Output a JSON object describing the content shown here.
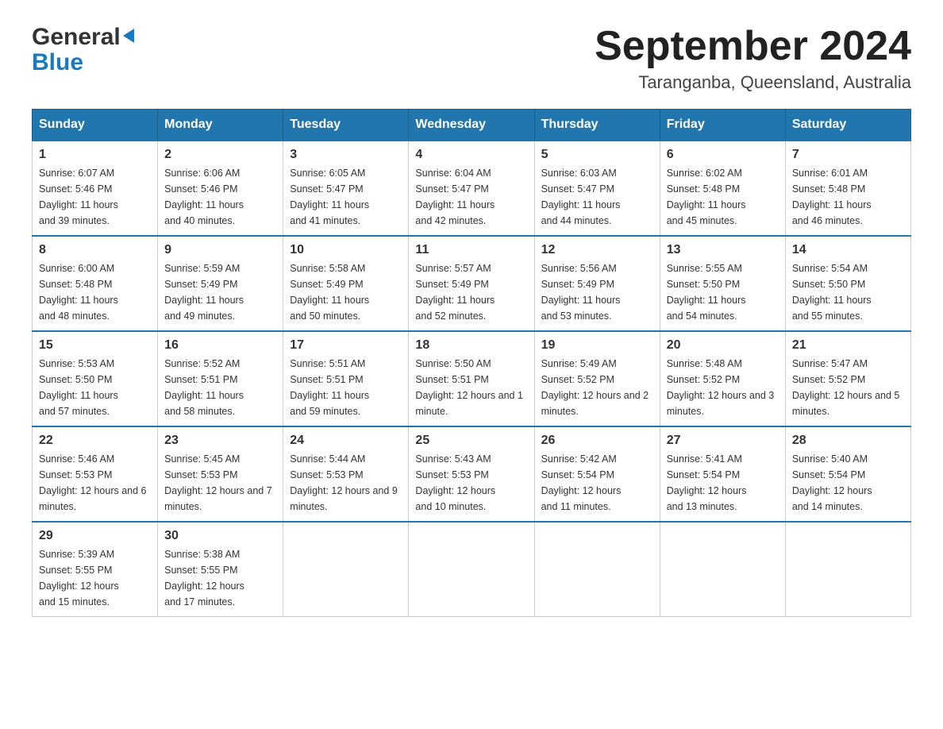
{
  "header": {
    "logo_general": "General",
    "logo_blue": "Blue",
    "month_title": "September 2024",
    "location": "Taranganba, Queensland, Australia"
  },
  "weekdays": [
    "Sunday",
    "Monday",
    "Tuesday",
    "Wednesday",
    "Thursday",
    "Friday",
    "Saturday"
  ],
  "weeks": [
    [
      {
        "day": "1",
        "sunrise": "6:07 AM",
        "sunset": "5:46 PM",
        "daylight": "11 hours and 39 minutes."
      },
      {
        "day": "2",
        "sunrise": "6:06 AM",
        "sunset": "5:46 PM",
        "daylight": "11 hours and 40 minutes."
      },
      {
        "day": "3",
        "sunrise": "6:05 AM",
        "sunset": "5:47 PM",
        "daylight": "11 hours and 41 minutes."
      },
      {
        "day": "4",
        "sunrise": "6:04 AM",
        "sunset": "5:47 PM",
        "daylight": "11 hours and 42 minutes."
      },
      {
        "day": "5",
        "sunrise": "6:03 AM",
        "sunset": "5:47 PM",
        "daylight": "11 hours and 44 minutes."
      },
      {
        "day": "6",
        "sunrise": "6:02 AM",
        "sunset": "5:48 PM",
        "daylight": "11 hours and 45 minutes."
      },
      {
        "day": "7",
        "sunrise": "6:01 AM",
        "sunset": "5:48 PM",
        "daylight": "11 hours and 46 minutes."
      }
    ],
    [
      {
        "day": "8",
        "sunrise": "6:00 AM",
        "sunset": "5:48 PM",
        "daylight": "11 hours and 48 minutes."
      },
      {
        "day": "9",
        "sunrise": "5:59 AM",
        "sunset": "5:49 PM",
        "daylight": "11 hours and 49 minutes."
      },
      {
        "day": "10",
        "sunrise": "5:58 AM",
        "sunset": "5:49 PM",
        "daylight": "11 hours and 50 minutes."
      },
      {
        "day": "11",
        "sunrise": "5:57 AM",
        "sunset": "5:49 PM",
        "daylight": "11 hours and 52 minutes."
      },
      {
        "day": "12",
        "sunrise": "5:56 AM",
        "sunset": "5:49 PM",
        "daylight": "11 hours and 53 minutes."
      },
      {
        "day": "13",
        "sunrise": "5:55 AM",
        "sunset": "5:50 PM",
        "daylight": "11 hours and 54 minutes."
      },
      {
        "day": "14",
        "sunrise": "5:54 AM",
        "sunset": "5:50 PM",
        "daylight": "11 hours and 55 minutes."
      }
    ],
    [
      {
        "day": "15",
        "sunrise": "5:53 AM",
        "sunset": "5:50 PM",
        "daylight": "11 hours and 57 minutes."
      },
      {
        "day": "16",
        "sunrise": "5:52 AM",
        "sunset": "5:51 PM",
        "daylight": "11 hours and 58 minutes."
      },
      {
        "day": "17",
        "sunrise": "5:51 AM",
        "sunset": "5:51 PM",
        "daylight": "11 hours and 59 minutes."
      },
      {
        "day": "18",
        "sunrise": "5:50 AM",
        "sunset": "5:51 PM",
        "daylight": "12 hours and 1 minute."
      },
      {
        "day": "19",
        "sunrise": "5:49 AM",
        "sunset": "5:52 PM",
        "daylight": "12 hours and 2 minutes."
      },
      {
        "day": "20",
        "sunrise": "5:48 AM",
        "sunset": "5:52 PM",
        "daylight": "12 hours and 3 minutes."
      },
      {
        "day": "21",
        "sunrise": "5:47 AM",
        "sunset": "5:52 PM",
        "daylight": "12 hours and 5 minutes."
      }
    ],
    [
      {
        "day": "22",
        "sunrise": "5:46 AM",
        "sunset": "5:53 PM",
        "daylight": "12 hours and 6 minutes."
      },
      {
        "day": "23",
        "sunrise": "5:45 AM",
        "sunset": "5:53 PM",
        "daylight": "12 hours and 7 minutes."
      },
      {
        "day": "24",
        "sunrise": "5:44 AM",
        "sunset": "5:53 PM",
        "daylight": "12 hours and 9 minutes."
      },
      {
        "day": "25",
        "sunrise": "5:43 AM",
        "sunset": "5:53 PM",
        "daylight": "12 hours and 10 minutes."
      },
      {
        "day": "26",
        "sunrise": "5:42 AM",
        "sunset": "5:54 PM",
        "daylight": "12 hours and 11 minutes."
      },
      {
        "day": "27",
        "sunrise": "5:41 AM",
        "sunset": "5:54 PM",
        "daylight": "12 hours and 13 minutes."
      },
      {
        "day": "28",
        "sunrise": "5:40 AM",
        "sunset": "5:54 PM",
        "daylight": "12 hours and 14 minutes."
      }
    ],
    [
      {
        "day": "29",
        "sunrise": "5:39 AM",
        "sunset": "5:55 PM",
        "daylight": "12 hours and 15 minutes."
      },
      {
        "day": "30",
        "sunrise": "5:38 AM",
        "sunset": "5:55 PM",
        "daylight": "12 hours and 17 minutes."
      },
      null,
      null,
      null,
      null,
      null
    ]
  ],
  "labels": {
    "sunrise": "Sunrise:",
    "sunset": "Sunset:",
    "daylight": "Daylight:"
  }
}
